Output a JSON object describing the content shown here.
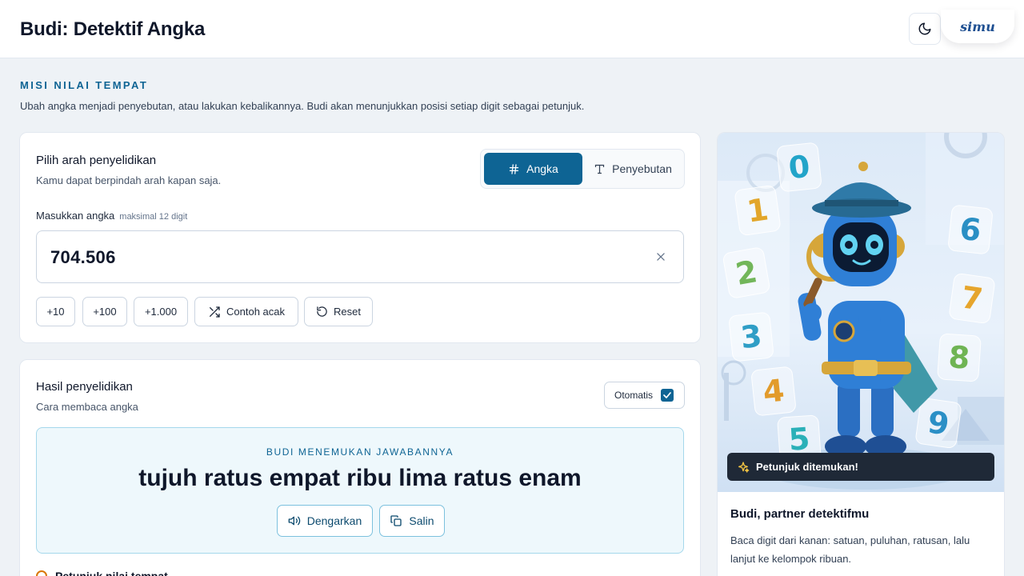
{
  "app": {
    "title": "Budi: Detektif Angka",
    "logo_text": "simu"
  },
  "intro": {
    "kicker": "MISI NILAI TEMPAT",
    "description": "Ubah angka menjadi penyebutan, atau lakukan kebalikannya. Budi akan menunjukkan posisi setiap digit sebagai petunjuk."
  },
  "direction_card": {
    "title": "Pilih arah penyelidikan",
    "subtitle": "Kamu dapat berpindah arah kapan saja.",
    "modes": [
      {
        "label": "Angka",
        "icon": "hash-icon",
        "active": true
      },
      {
        "label": "Penyebutan",
        "icon": "text-icon",
        "active": false
      }
    ],
    "input_label": "Masukkan angka",
    "input_hint": "maksimal 12 digit",
    "input_value": "704.506",
    "quick_buttons": [
      "+10",
      "+100",
      "+1.000"
    ],
    "random_label": "Contoh acak",
    "reset_label": "Reset"
  },
  "result_card": {
    "title": "Hasil penyelidikan",
    "subtitle": "Cara membaca angka",
    "auto_label": "Otomatis",
    "auto_checked": true,
    "kicker": "BUDI MENEMUKAN JAWABANNYA",
    "answer": "tujuh ratus empat ribu lima ratus enam",
    "listen_label": "Dengarkan",
    "copy_label": "Salin",
    "next_section": "Petunjuk nilai tempat"
  },
  "side": {
    "badge": "Petunjuk ditemukan!",
    "title": "Budi, partner detektifmu",
    "text": "Baca digit dari kanan: satuan, puluhan, ratusan, lalu lanjut ke kelompok ribuan.",
    "digits": [
      {
        "d": "0",
        "color": "#22a4c9"
      },
      {
        "d": "1",
        "color": "#e2a62a"
      },
      {
        "d": "2",
        "color": "#72b65a"
      },
      {
        "d": "3",
        "color": "#2f9ec6"
      },
      {
        "d": "4",
        "color": "#e29b2b"
      },
      {
        "d": "5",
        "color": "#2ab0b8"
      },
      {
        "d": "6",
        "color": "#2a8fc4"
      },
      {
        "d": "7",
        "color": "#e6a52c"
      },
      {
        "d": "8",
        "color": "#6fb454"
      },
      {
        "d": "9",
        "color": "#2b8fc6"
      }
    ]
  },
  "colors": {
    "accent": "#0e6494",
    "result_bg": "#eef8fc",
    "badge_bg": "#1f2937"
  }
}
